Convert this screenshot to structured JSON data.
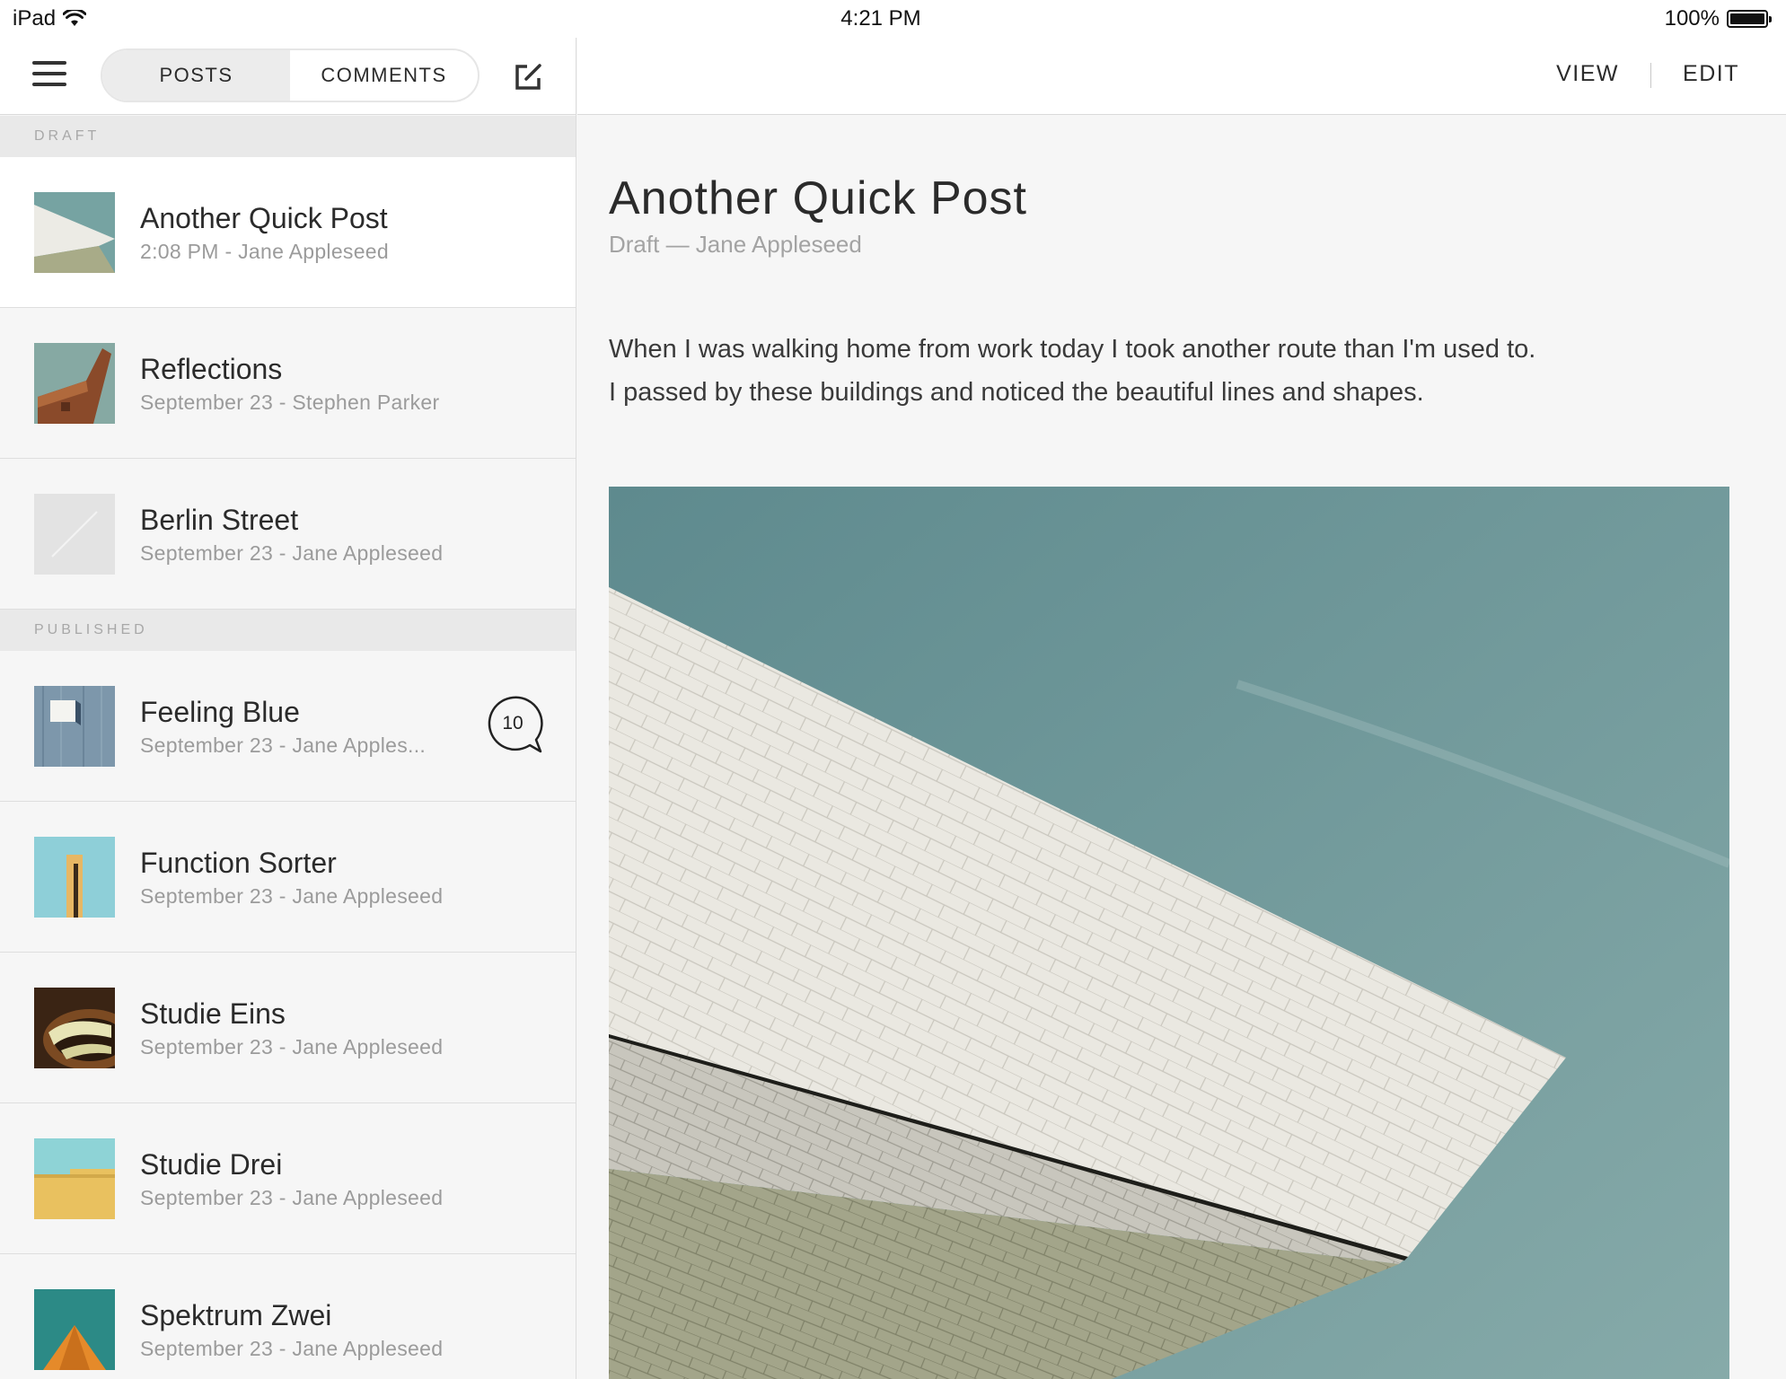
{
  "status_bar": {
    "device": "iPad",
    "time": "4:21 PM",
    "battery": "100%",
    "battery_level": 1.0,
    "wifi_icon": "wifi-icon",
    "battery_icon": "battery-icon"
  },
  "sidebar": {
    "menu_icon": "hamburger-menu-icon",
    "compose_icon": "compose-icon",
    "segments": [
      {
        "label": "POSTS",
        "active": true
      },
      {
        "label": "COMMENTS",
        "active": false
      }
    ],
    "sections": [
      {
        "label": "DRAFT"
      },
      {
        "label": "PUBLISHED"
      }
    ],
    "posts": [
      {
        "title": "Another Quick Post",
        "meta": "2:08 PM - Jane Appleseed",
        "selected": true
      },
      {
        "title": "Reflections",
        "meta": "September 23 - Stephen Parker"
      },
      {
        "title": "Berlin Street",
        "meta": "September 23 - Jane Appleseed"
      },
      {
        "title": "Feeling Blue",
        "meta": "September 23 - Jane Apples...",
        "comments": "10"
      },
      {
        "title": "Function Sorter",
        "meta": "September 23 - Jane Appleseed"
      },
      {
        "title": "Studie Eins",
        "meta": "September 23 - Jane Appleseed"
      },
      {
        "title": "Studie Drei",
        "meta": "September 23 - Jane Appleseed"
      },
      {
        "title": "Spektrum Zwei",
        "meta": "September 23 - Jane Appleseed"
      }
    ]
  },
  "content": {
    "view_label": "VIEW",
    "edit_label": "EDIT",
    "title": "Another Quick Post",
    "meta": "Draft — Jane Appleseed",
    "body_lines": [
      "When I was walking home from work today I took another route than I'm used to.",
      "I passed by these buildings and noticed the beautiful lines and shapes."
    ]
  },
  "colors": {
    "background": "#f6f6f6",
    "text": "#2b2b2b",
    "muted": "#9b9b9b",
    "section_bg": "#e9e9e9",
    "sky": "#6f9a9d"
  }
}
